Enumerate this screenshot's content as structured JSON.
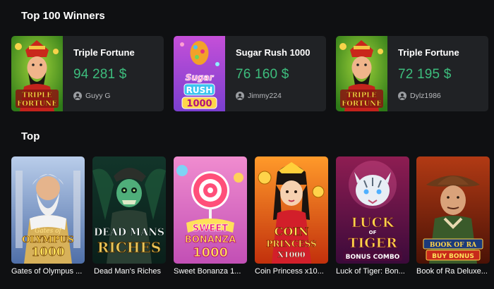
{
  "sections": {
    "winners_title": "Top 100 Winners",
    "top_title": "Top"
  },
  "winners": [
    {
      "game": "Triple Fortune",
      "amount": "94 281 $",
      "user": "Guyy G",
      "thumb_text": "TRIPLE FORTUNE"
    },
    {
      "game": "Sugar Rush 1000",
      "amount": "76 160 $",
      "user": "Jimmy224",
      "thumb_text": "Sugar RUSH 1000"
    },
    {
      "game": "Triple Fortune",
      "amount": "72 195 $",
      "user": "Dylz1986",
      "thumb_text": "TRIPLE FORTUNE"
    }
  ],
  "top_games": [
    {
      "title": "Gates of Olympus ...",
      "art_text": "Gates of OLYMPUS 1000"
    },
    {
      "title": "Dead Man's Riches",
      "art_text": "DEAD MANS RICHES"
    },
    {
      "title": "Sweet Bonanza 1...",
      "art_text": "SWEET BONANZA 1000"
    },
    {
      "title": "Coin Princess x10...",
      "art_text": "COIN PRINCESS X1000"
    },
    {
      "title": "Luck of Tiger: Bon...",
      "art_text": "LUCK OF TIGER BONUS COMBO"
    },
    {
      "title": "Book of Ra Deluxe...",
      "art_text": "BOOK OF RA BUY BONUS"
    }
  ],
  "icons": {
    "user": "user-icon"
  },
  "colors": {
    "background": "#0f1012",
    "card": "#202225",
    "amount": "#3dbd7d",
    "muted": "#b8babd"
  }
}
